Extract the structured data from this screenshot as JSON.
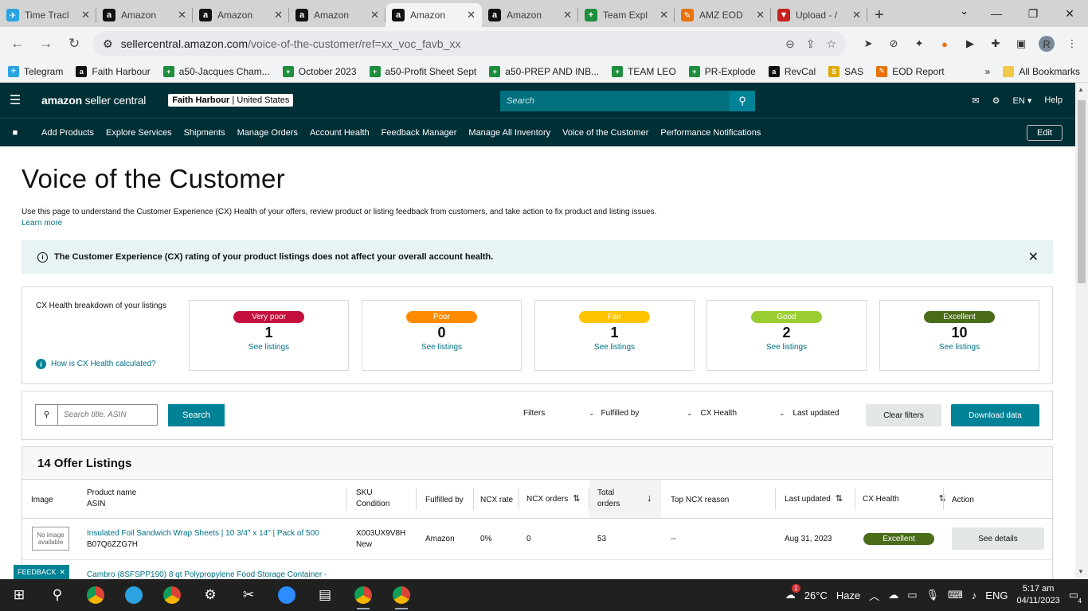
{
  "browser": {
    "tabs": [
      {
        "title": "Time Tracl",
        "icon": "telegram-icon",
        "color": "#2aa3e0",
        "glyph": "✈",
        "active": false
      },
      {
        "title": "Amazon",
        "icon": "amazon-icon",
        "color": "#111111",
        "glyph": "a",
        "active": false
      },
      {
        "title": "Amazon",
        "icon": "amazon-icon",
        "color": "#111111",
        "glyph": "a",
        "active": false
      },
      {
        "title": "Amazon",
        "icon": "amazon-icon",
        "color": "#111111",
        "glyph": "a",
        "active": false
      },
      {
        "title": "Amazon",
        "icon": "amazon-icon",
        "color": "#111111",
        "glyph": "a",
        "active": true
      },
      {
        "title": "Amazon",
        "icon": "amazon-icon",
        "color": "#111111",
        "glyph": "a",
        "active": false
      },
      {
        "title": "Team Expl",
        "icon": "sheets-icon",
        "color": "#1e8e3e",
        "glyph": "+",
        "active": false
      },
      {
        "title": "AMZ EOD",
        "icon": "pen-icon",
        "color": "#e8710a",
        "glyph": "✎",
        "active": false
      },
      {
        "title": "Upload - /",
        "icon": "upload-icon",
        "color": "#c5221f",
        "glyph": "▼",
        "active": false
      }
    ],
    "url_host": "sellercentral.amazon.com",
    "url_path": "/voice-of-the-customer/ref=xx_voc_favb_xx",
    "bookmarks": [
      {
        "label": "Telegram",
        "icon": "telegram-icon",
        "color": "#2aa3e0",
        "glyph": "✈"
      },
      {
        "label": "Faith Harbour",
        "icon": "amazon-icon",
        "color": "#111111",
        "glyph": "a"
      },
      {
        "label": "a50-Jacques Cham...",
        "icon": "sheets-icon",
        "color": "#1e8e3e",
        "glyph": "+"
      },
      {
        "label": "October 2023",
        "icon": "sheets-icon",
        "color": "#1e8e3e",
        "glyph": "+"
      },
      {
        "label": "a50-Profit Sheet Sept",
        "icon": "sheets-icon",
        "color": "#1e8e3e",
        "glyph": "+"
      },
      {
        "label": "a50-PREP AND INB...",
        "icon": "sheets-icon",
        "color": "#1e8e3e",
        "glyph": "+"
      },
      {
        "label": "TEAM LEO",
        "icon": "sheets-icon",
        "color": "#1e8e3e",
        "glyph": "+"
      },
      {
        "label": "PR-Explode",
        "icon": "sheets-icon",
        "color": "#1e8e3e",
        "glyph": "+"
      },
      {
        "label": "RevCal",
        "icon": "amazon-icon",
        "color": "#111111",
        "glyph": "a"
      },
      {
        "label": "SAS",
        "icon": "sas-icon",
        "color": "#e0a800",
        "glyph": "S"
      },
      {
        "label": "EOD Report",
        "icon": "pen-icon",
        "color": "#e8710a",
        "glyph": "✎"
      }
    ],
    "more_bookmarks": "»",
    "all_bookmarks": "All Bookmarks",
    "profile_initial": "R"
  },
  "header": {
    "logo_main": "amazon",
    "logo_sub": " seller central",
    "store_name": "Faith Harbour",
    "store_sep": " | ",
    "marketplace": "United States",
    "search_placeholder": "Search",
    "lang": "EN",
    "help": "Help"
  },
  "nav": {
    "items": [
      "Add Products",
      "Explore Services",
      "Shipments",
      "Manage Orders",
      "Account Health",
      "Feedback Manager",
      "Manage All Inventory",
      "Voice of the Customer",
      "Performance Notifications"
    ],
    "edit": "Edit"
  },
  "page": {
    "title": "Voice of the Customer",
    "description": "Use this page to understand the Customer Experience (CX) Health of your offers, review product or listing feedback from customers, and take action to fix product and listing issues.",
    "learn_more": "Learn more",
    "notice": "The Customer Experience (CX) rating of your product listings does not affect your overall account health."
  },
  "cx": {
    "label": "CX Health breakdown of your listings",
    "how": "How is CX Health calculated?",
    "cards": [
      {
        "badge": "Very poor",
        "count": "1",
        "link": "See listings",
        "color": "#c40f3c"
      },
      {
        "badge": "Poor",
        "count": "0",
        "link": "See listings",
        "color": "#ff8c00"
      },
      {
        "badge": "Fair",
        "count": "1",
        "link": "See listings",
        "color": "#ffc400"
      },
      {
        "badge": "Good",
        "count": "2",
        "link": "See listings",
        "color": "#9acd32"
      },
      {
        "badge": "Excellent",
        "count": "10",
        "link": "See listings",
        "color": "#4a6b1a"
      }
    ]
  },
  "filters": {
    "search_placeholder": "Search title, ASIN",
    "search_button": "Search",
    "filters_label": "Filters",
    "dropdowns": [
      "Fulfilled by",
      "CX Health",
      "Last updated"
    ],
    "clear": "Clear filters",
    "download": "Download data"
  },
  "table": {
    "title": "14 Offer Listings",
    "columns": {
      "image": "Image",
      "product_name": "Product name",
      "asin": "ASIN",
      "sku": "SKU",
      "condition": "Condition",
      "fulfilled_by": "Fulfilled by",
      "ncx_rate": "NCX rate",
      "ncx_orders": "NCX orders",
      "total_orders_1": "Total",
      "total_orders_2": "orders",
      "top_ncx": "Top NCX reason",
      "last_updated": "Last updated",
      "cx_health": "CX Health",
      "action": "Action"
    },
    "rows": [
      {
        "no_image_1": "No image",
        "no_image_2": "available",
        "product": "Insulated Foil Sandwich Wrap Sheets | 10 3/4\" x 14\" | Pack of 500",
        "asin": "B07Q6ZZG7H",
        "sku": "X003UX9V8H",
        "condition": "New",
        "fulfilled": "Amazon",
        "ncx_rate": "0%",
        "ncx_orders": "0",
        "total": "53",
        "reason": "--",
        "updated": "Aug 31, 2023",
        "health": "Excellent",
        "action": "See details"
      },
      {
        "product": "Cambro (8SFSPP190) 8 qt Polypropylene Food Storage Container -"
      }
    ]
  },
  "feedback": "FEEDBACK",
  "taskbar": {
    "weather_temp": "26°C",
    "weather_desc": "Haze",
    "lang": "ENG",
    "time": "5:17 am",
    "date": "04/11/2023",
    "notif_count": "4",
    "weather_badge": "1"
  }
}
